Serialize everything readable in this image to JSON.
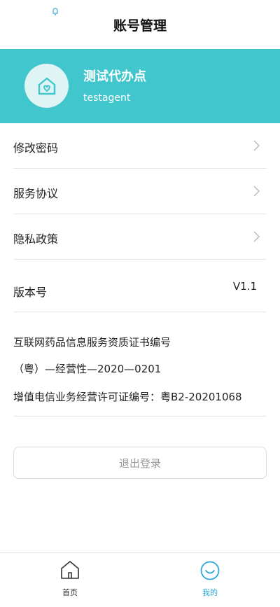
{
  "header": {
    "title": "账号管理"
  },
  "profile": {
    "name": "测试代办点",
    "account": "testagent"
  },
  "menu": {
    "change_password": "修改密码",
    "service_agreement": "服务协议",
    "privacy_policy": "隐私政策",
    "version_label": "版本号",
    "version_value": "V1.1"
  },
  "license": {
    "line1": "互联网药品信息服务资质证书编号",
    "line2": "（粤）—经营性—2020—0201",
    "line3": "增值电信业务经营许可证编号：粤B2-20201068"
  },
  "logout": {
    "label": "退出登录"
  },
  "tabbar": {
    "home": "首页",
    "mine": "我的"
  },
  "colors": {
    "accent": "#40c6cc",
    "tab_active": "#2aa8d8",
    "tab_inactive": "#333333"
  }
}
